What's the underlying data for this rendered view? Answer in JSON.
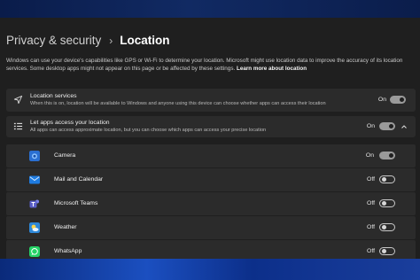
{
  "header": {
    "parent": "Privacy & security",
    "separator": "›",
    "title": "Location"
  },
  "description": {
    "text": "Windows can use your device's capabilities like GPS or Wi-Fi to determine your location. Microsoft might use location data to improve the accuracy of its location services. Some desktop apps might not appear on this page or be affected by these settings.",
    "link": "Learn more about location"
  },
  "location_services": {
    "title": "Location services",
    "subtitle": "When this is on, location will be available to Windows and anyone using this device can choose whether apps can access their location",
    "state": "On",
    "icon": "location-arrow-icon"
  },
  "apps_access": {
    "title": "Let apps access your location",
    "subtitle": "All apps can access approximate location, but you can choose which apps can access your precise location",
    "state": "On",
    "icon": "list-icon"
  },
  "apps": [
    {
      "name": "Camera",
      "state": "On",
      "icon": "camera-icon",
      "color": "#3a8ee6"
    },
    {
      "name": "Mail and Calendar",
      "state": "Off",
      "icon": "mail-icon",
      "color": "#1e7be0"
    },
    {
      "name": "Microsoft Teams",
      "state": "Off",
      "icon": "teams-icon",
      "color": "#5b5fc7"
    },
    {
      "name": "Weather",
      "state": "Off",
      "icon": "weather-icon",
      "color": "#2e88d8"
    },
    {
      "name": "WhatsApp",
      "state": "Off",
      "icon": "whatsapp-icon",
      "color": "#25d366"
    }
  ],
  "colors": {
    "window_bg": "#1f1f1f",
    "card_bg": "#2b2b2b",
    "toggle_on": "#9a9a9a"
  }
}
